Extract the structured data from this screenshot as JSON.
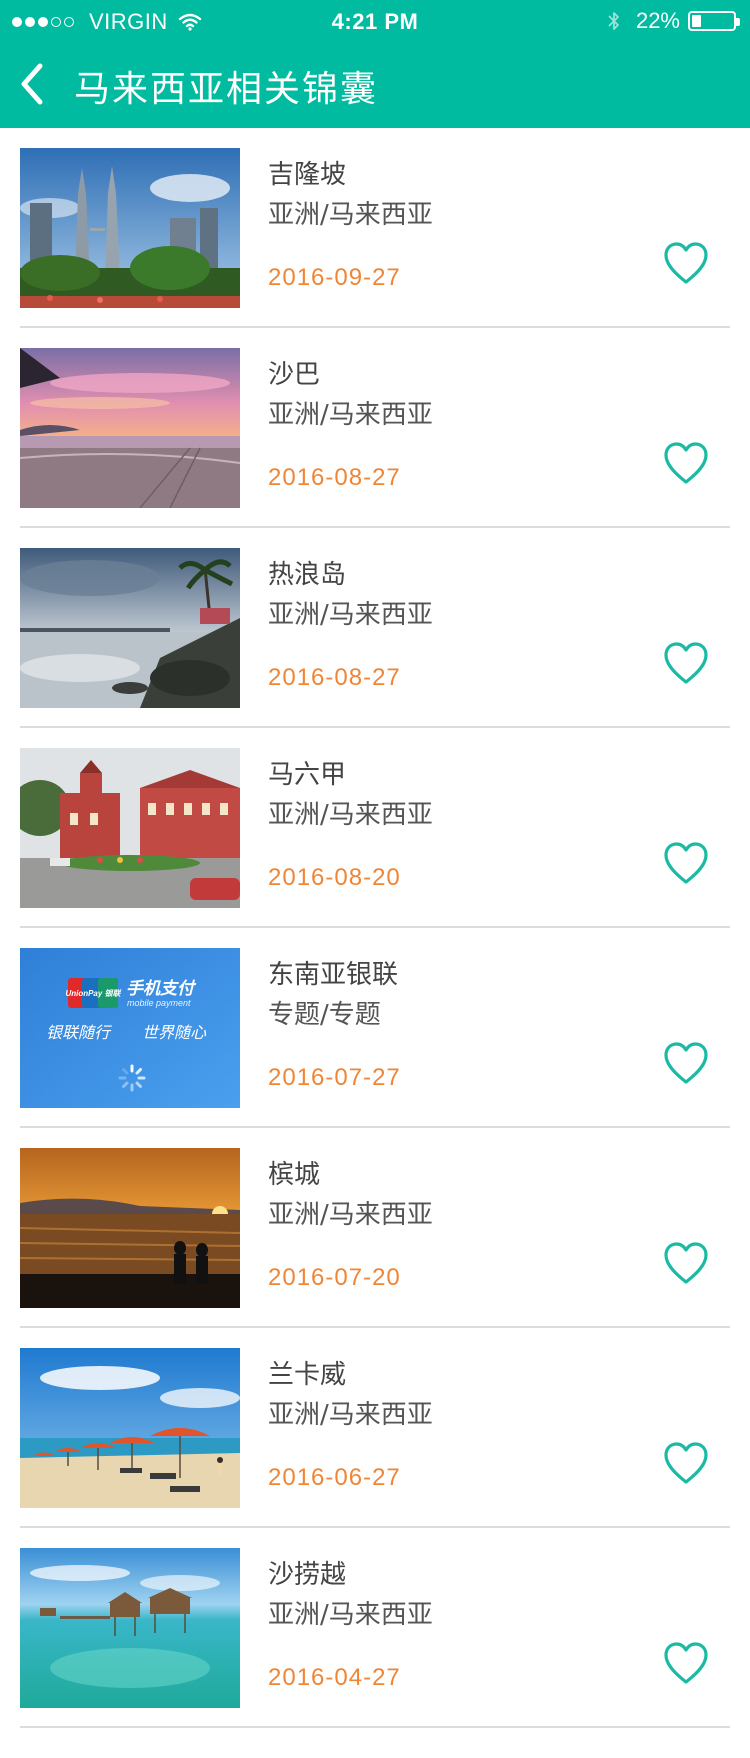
{
  "status_bar": {
    "carrier": "VIRGIN",
    "time": "4:21 PM",
    "battery": "22%",
    "battery_level": 0.22
  },
  "nav": {
    "title": "马来西亚相关锦囊"
  },
  "items": [
    {
      "name": "吉隆坡",
      "region": "亚洲/马来西亚",
      "date": "2016-09-27"
    },
    {
      "name": "沙巴",
      "region": "亚洲/马来西亚",
      "date": "2016-08-27"
    },
    {
      "name": "热浪岛",
      "region": "亚洲/马来西亚",
      "date": "2016-08-27"
    },
    {
      "name": "马六甲",
      "region": "亚洲/马来西亚",
      "date": "2016-08-20"
    },
    {
      "name": "东南亚银联",
      "region": "专题/专题",
      "date": "2016-07-27"
    },
    {
      "name": "槟城",
      "region": "亚洲/马来西亚",
      "date": "2016-07-20"
    },
    {
      "name": "兰卡威",
      "region": "亚洲/马来西亚",
      "date": "2016-06-27"
    },
    {
      "name": "沙捞越",
      "region": "亚洲/马来西亚",
      "date": "2016-04-27"
    }
  ],
  "unionpay_banner": {
    "logo": "UnionPay 银联",
    "title": "手机支付",
    "subtitle": "mobile payment",
    "slogan_left": "银联随行",
    "slogan_right": "世界随心"
  },
  "colors": {
    "header": "#00bba0",
    "date": "#f08536",
    "heart": "#1cbaa5",
    "divider": "#dcdcdc"
  },
  "icons": {
    "back": "chevron-left-icon",
    "favorite": "heart-outline-icon",
    "wifi": "wifi-icon",
    "bluetooth": "bluetooth-icon",
    "battery": "battery-icon"
  }
}
